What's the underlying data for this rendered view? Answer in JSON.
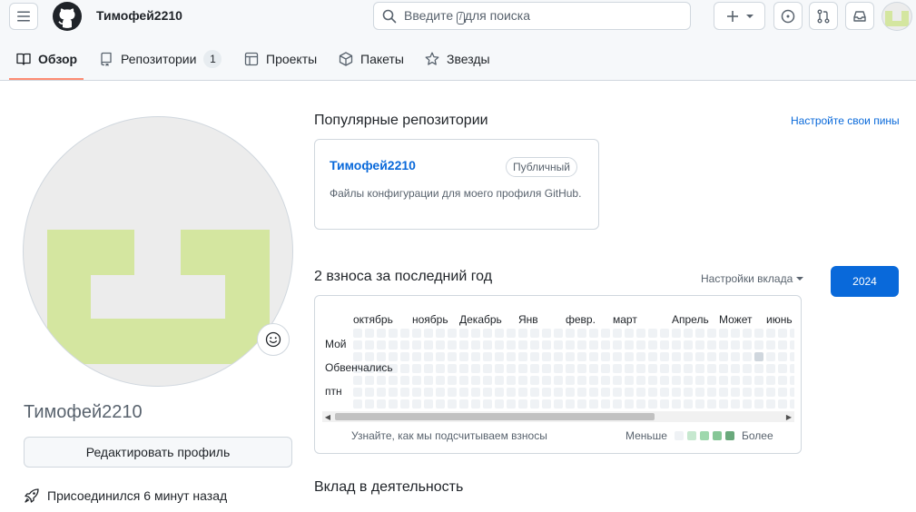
{
  "header": {
    "user_title": "Тимофей2210",
    "search_prefix": "Введите",
    "search_key": "/",
    "search_suffix": "для поиска"
  },
  "tabs": [
    {
      "label": "Обзор",
      "icon": "book-icon"
    },
    {
      "label": "Репозитории",
      "icon": "repo-icon",
      "count": "1"
    },
    {
      "label": "Проекты",
      "icon": "table-icon"
    },
    {
      "label": "Пакеты",
      "icon": "package-icon"
    },
    {
      "label": "Звезды",
      "icon": "star-icon"
    }
  ],
  "profile": {
    "username": "Тимофей2210",
    "edit_label": "Редактировать профиль",
    "joined": "Присоединился 6 минут назад"
  },
  "popular": {
    "title": "Популярные репозитории",
    "customize_link": "Настройте свои пины",
    "repo": {
      "name": "Тимофей2210",
      "visibility": "Публичный",
      "description": "Файлы конфигурации для моего профиля GitHub."
    }
  },
  "contributions": {
    "title": "2 взноса за последний год",
    "settings_label": "Настройки вклада",
    "year": "2024",
    "months": [
      "октябрь",
      "ноябрь",
      "Декабрь",
      "Янв",
      "февр.",
      "март",
      "Апрель",
      "Может",
      "июнь"
    ],
    "days": [
      "Мой",
      "Обвенчались",
      "птн"
    ],
    "learn_text": "Узнайте, как мы подсчитываем взносы",
    "less": "Меньше",
    "more": "Более"
  },
  "activity": {
    "title": "Вклад в деятельность"
  },
  "colors": {
    "accent": "#0969da",
    "tab_underline": "#fd8c73",
    "avatar_green": "#d4e6a0",
    "legend": [
      "#eff2f5",
      "#aceebb",
      "#4ac26b",
      "#2da44e",
      "#116329"
    ]
  }
}
